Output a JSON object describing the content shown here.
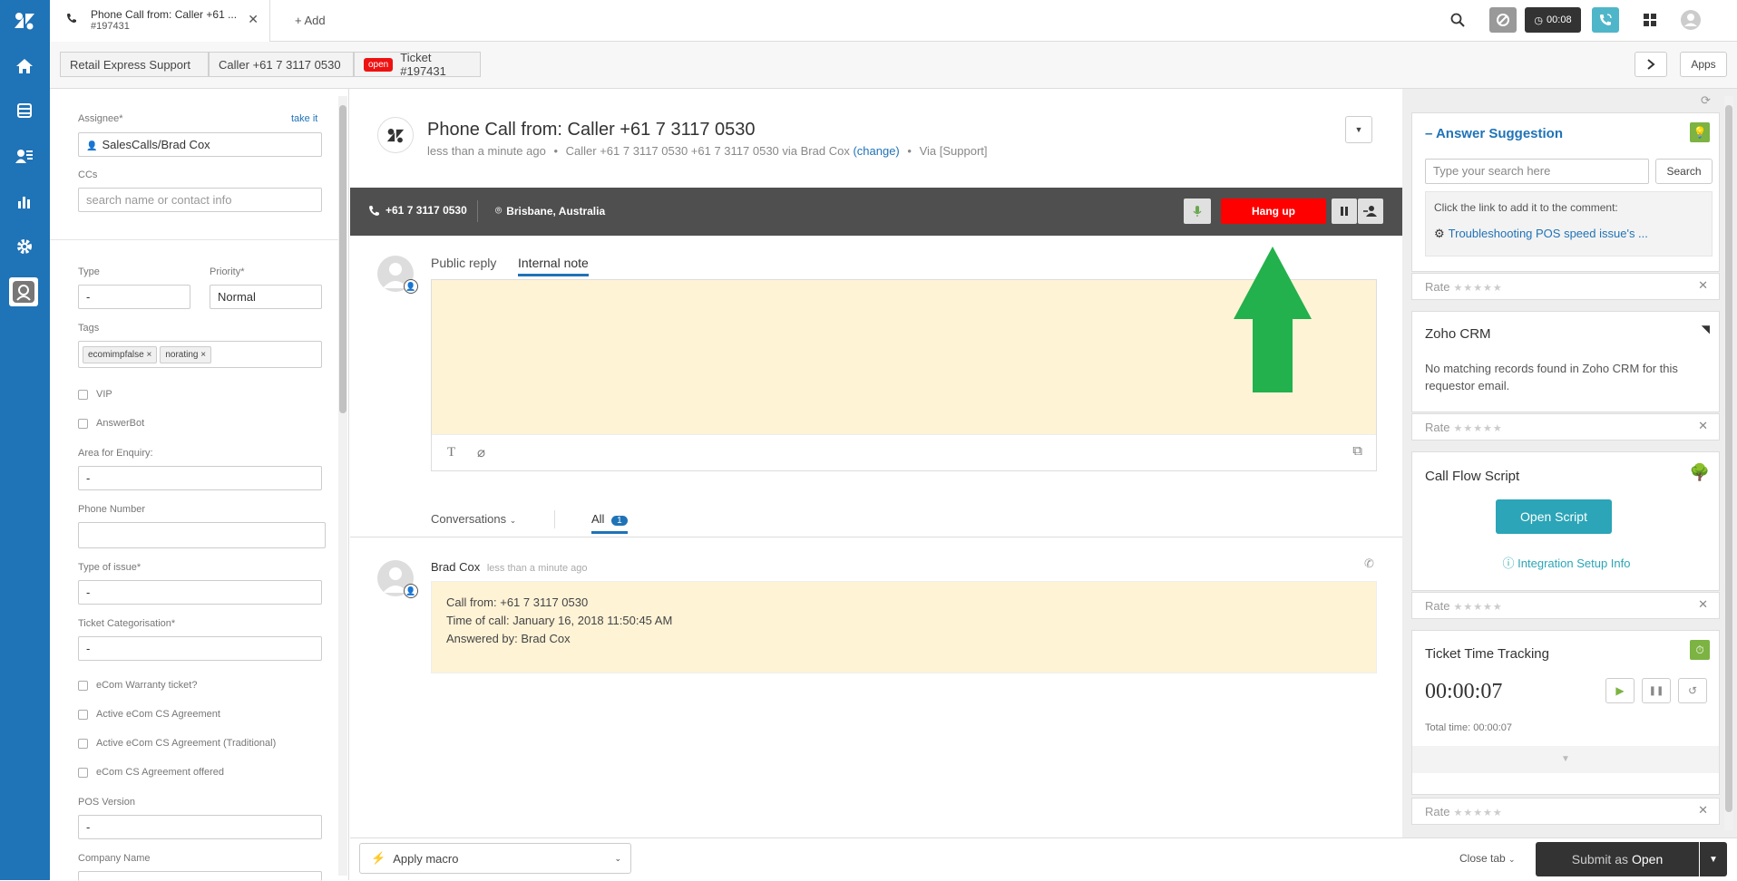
{
  "tab": {
    "title": "Phone Call from: Caller +61 ...",
    "subtitle": "#197431",
    "add_label": "Add"
  },
  "topbar": {
    "timer": "00:08"
  },
  "breadcrumbs": {
    "org": "Retail Express Support",
    "caller": "Caller +61 7 3117 0530",
    "status": "open",
    "ticket": "Ticket #197431"
  },
  "apps_label": "Apps",
  "left": {
    "assignee_label": "Assignee*",
    "take_it": "take it",
    "assignee_value": "SalesCalls/Brad Cox",
    "ccs_label": "CCs",
    "ccs_placeholder": "search name or contact info",
    "type_label": "Type",
    "type_value": "-",
    "priority_label": "Priority*",
    "priority_value": "Normal",
    "tags_label": "Tags",
    "tags": [
      "ecomimpfalse",
      "norating"
    ],
    "vip_label": "VIP",
    "answerbot_label": "AnswerBot",
    "area_label": "Area for Enquiry:",
    "area_value": "-",
    "phone_label": "Phone Number",
    "phone_value": "",
    "issue_label": "Type of issue*",
    "issue_value": "-",
    "cat_label": "Ticket Categorisation*",
    "cat_value": "-",
    "warranty_label": "eCom Warranty ticket?",
    "active_label": "Active eCom CS Agreement",
    "active_trad_label": "Active eCom CS Agreement (Traditional)",
    "offered_label": "eCom CS Agreement offered",
    "pos_label": "POS Version",
    "pos_value": "-",
    "company_label": "Company Name"
  },
  "ticket": {
    "title": "Phone Call from: Caller +61 7 3117 0530",
    "meta_time": "less than a minute ago",
    "meta_caller": "Caller +61 7 3117 0530 +61 7 3117 0530 via Brad Cox",
    "meta_change": "(change)",
    "meta_via": "Via [Support]"
  },
  "call": {
    "number": "+61 7 3117 0530",
    "location": "Brisbane, Australia",
    "hangup": "Hang up"
  },
  "composer": {
    "public_reply": "Public reply",
    "internal_note": "Internal note"
  },
  "conversations": {
    "label": "Conversations",
    "all_label": "All",
    "all_count": "1"
  },
  "message": {
    "author": "Brad Cox",
    "time": "less than a minute ago",
    "line1": "Call from: +61 7 3117 0530",
    "line2": "Time of call: January 16, 2018 11:50:45 AM",
    "line3": "Answered by: Brad Cox"
  },
  "apps": {
    "answer_title": "Answer Suggestion",
    "search_placeholder": "Type your search here",
    "search_button": "Search",
    "click_hint": "Click the link to add it to the comment:",
    "suggestion": "Troubleshooting POS speed issue's ...",
    "rate_label": "Rate",
    "zoho_title": "Zoho CRM",
    "zoho_text": "No matching records found in Zoho CRM for this requestor email.",
    "callflow_title": "Call Flow Script",
    "open_script": "Open Script",
    "integration_info": "Integration Setup Info",
    "time_title": "Ticket Time Tracking",
    "time_value": "00:00:07",
    "total_label": "Total time:",
    "total_value": "00:00:07"
  },
  "bottom": {
    "macro": "Apply macro",
    "close_tab": "Close tab",
    "submit_prefix": "Submit as",
    "submit_status": "Open"
  },
  "colors": {
    "brand_blue": "#1f73b7",
    "hangup_red": "#ff0000",
    "arrow_green": "#22b14c",
    "script_teal": "#2ba5b7",
    "note_yellow": "#fff3d6"
  }
}
